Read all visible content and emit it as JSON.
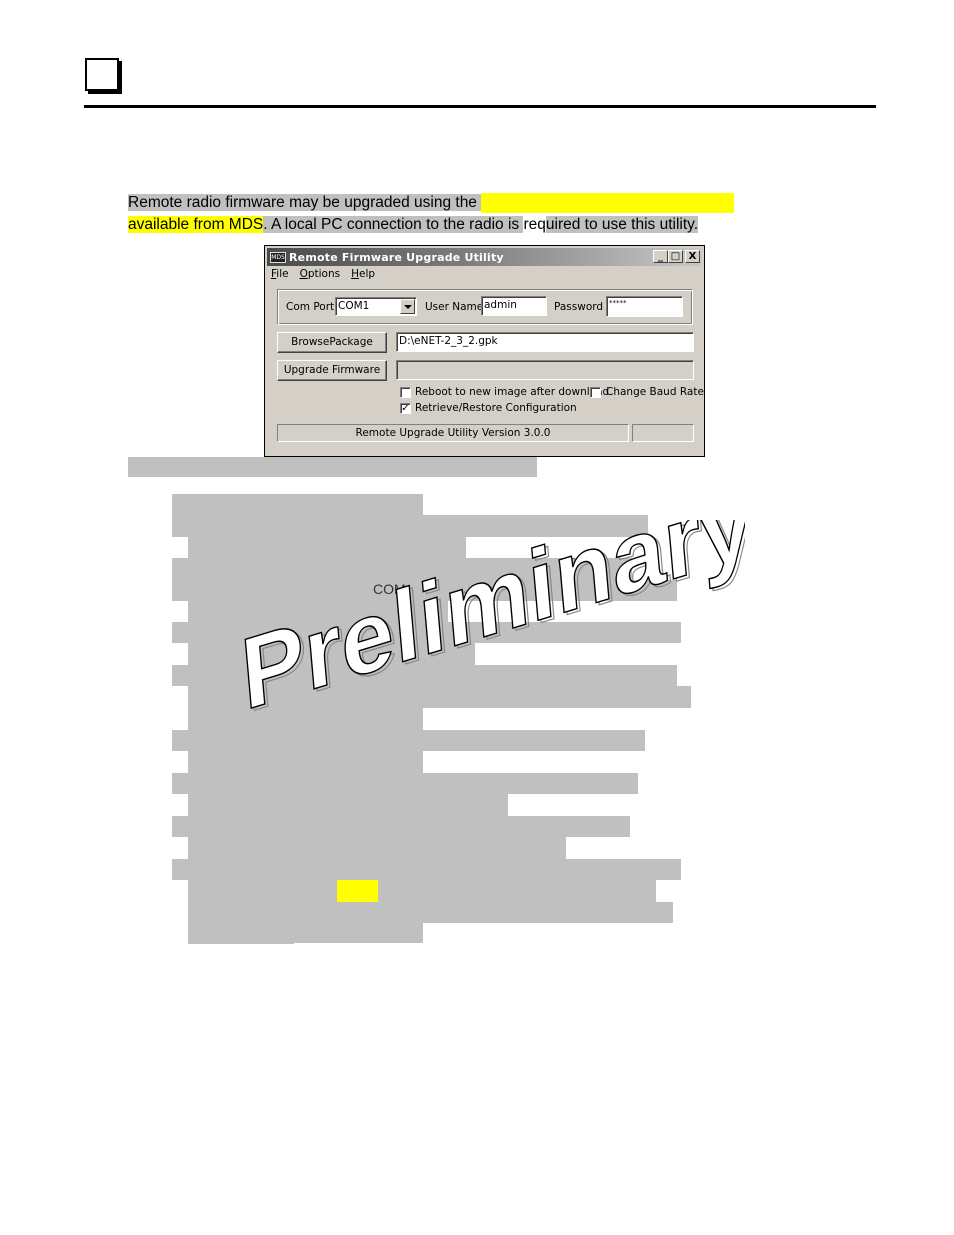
{
  "page": {
    "chapter_marker": "",
    "intro": {
      "line1_text": "Remote radio firmware may be upgraded using the ",
      "line2_highlight": "available from MDS",
      "line2_text_a": ". A local PC connection to the radio is ",
      "line2_text_b": "req",
      "line2_text_c": "uired to use this utility."
    },
    "colors": {
      "redaction_gray": "#c0c0c0",
      "highlight_yellow": "#ffff00"
    },
    "stray_text": "COM",
    "watermark": "Preliminary"
  },
  "window": {
    "title": "Remote Firmware Upgrade Utility",
    "app_icon_label": "MDS",
    "controls": {
      "minimize": "_",
      "maximize": "□",
      "close": "X"
    },
    "menu": [
      {
        "label": "File",
        "accel": "F",
        "rest": "ile"
      },
      {
        "label": "Options",
        "accel": "O",
        "rest": "ptions"
      },
      {
        "label": "Help",
        "accel": "H",
        "rest": "elp"
      }
    ],
    "com_port_label": "Com Port",
    "com_port_value": "COM1",
    "user_name_label": "User Name",
    "user_name_value": "admin",
    "password_label": "Password",
    "password_value": "*****",
    "browse_button": "BrowsePackage",
    "package_path": "D:\\eNET-2_3_2.gpk",
    "upgrade_button": "Upgrade Firmware",
    "progress_value": "",
    "checkboxes": [
      {
        "label": "Reboot to new image after download",
        "checked": false
      },
      {
        "label": "Change Baud Rate",
        "checked": false
      },
      {
        "label": "Retrieve/Restore Configuration",
        "checked": true
      }
    ],
    "status_text": "Remote Upgrade Utility Version 3.0.0",
    "status_extra": ""
  }
}
